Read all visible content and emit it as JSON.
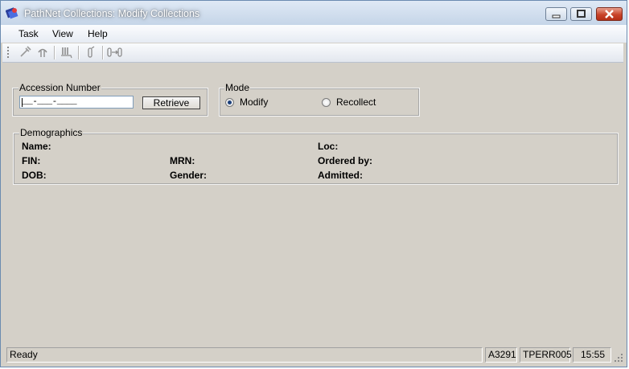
{
  "window": {
    "title": "PathNet Collections: Modify Collections",
    "controls": {
      "minimize": "minimize-icon",
      "maximize": "maximize-icon",
      "close": "close-icon"
    }
  },
  "menu": {
    "items": [
      "Task",
      "View",
      "Help"
    ]
  },
  "toolbar": {
    "buttons": [
      "syringe-icon",
      "tourniquet-icon",
      "tube-rack-icon",
      "specimen-tube-icon",
      "transfer-icon"
    ]
  },
  "accession": {
    "legend": "Accession Number",
    "value": "__-___-____",
    "retrieve_label": "Retrieve"
  },
  "mode": {
    "legend": "Mode",
    "options": [
      {
        "label": "Modify",
        "selected": true
      },
      {
        "label": "Recollect",
        "selected": false
      }
    ]
  },
  "demographics": {
    "legend": "Demographics",
    "name_label": "Name:",
    "loc_label": "Loc:",
    "fin_label": "FIN:",
    "mrn_label": "MRN:",
    "ordered_by_label": "Ordered by:",
    "dob_label": "DOB:",
    "gender_label": "Gender:",
    "admitted_label": "Admitted:"
  },
  "status": {
    "message": "Ready",
    "code": "A3291",
    "user": "TPERR005",
    "time": "15:55"
  },
  "colors": {
    "title_text": "#ffffff",
    "close_button": "#c8432a",
    "window_bg": "#d4d0c8",
    "radio_dot": "#1b3f7a"
  }
}
